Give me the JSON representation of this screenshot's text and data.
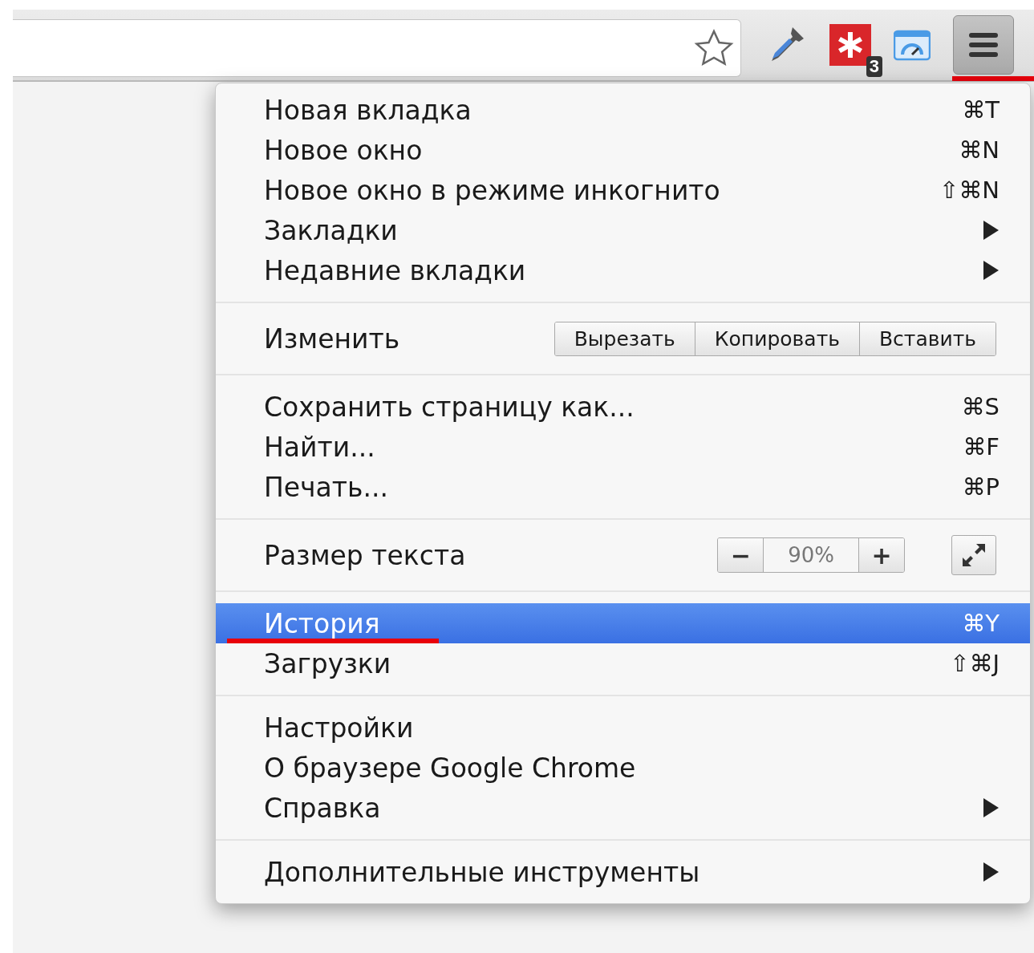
{
  "toolbar": {
    "badge": "3",
    "menu_button": {
      "pressed": true,
      "marked": true
    }
  },
  "menu": {
    "sections": [
      {
        "rows": [
          {
            "kind": "item",
            "label": "Новая вкладка",
            "shortcut": "⌘T",
            "submenu": false,
            "selected": false,
            "marked": false
          },
          {
            "kind": "item",
            "label": "Новое окно",
            "shortcut": "⌘N",
            "submenu": false,
            "selected": false,
            "marked": false
          },
          {
            "kind": "item",
            "label": "Новое окно в режиме инкогнито",
            "shortcut": "⇧⌘N",
            "submenu": false,
            "selected": false,
            "marked": false
          },
          {
            "kind": "item",
            "label": "Закладки",
            "submenu": true,
            "selected": false,
            "marked": false
          },
          {
            "kind": "item",
            "label": "Недавние вкладки",
            "submenu": true,
            "selected": false,
            "marked": false
          }
        ]
      },
      {
        "rows": [
          {
            "kind": "edit",
            "label": "Изменить",
            "buttons": [
              "Вырезать",
              "Копировать",
              "Вставить"
            ]
          }
        ]
      },
      {
        "rows": [
          {
            "kind": "item",
            "label": "Сохранить страницу как...",
            "shortcut": "⌘S",
            "submenu": false,
            "selected": false,
            "marked": false
          },
          {
            "kind": "item",
            "label": "Найти...",
            "shortcut": "⌘F",
            "submenu": false,
            "selected": false,
            "marked": false
          },
          {
            "kind": "item",
            "label": "Печать...",
            "shortcut": "⌘P",
            "submenu": false,
            "selected": false,
            "marked": false
          }
        ]
      },
      {
        "rows": [
          {
            "kind": "zoom",
            "label": "Размер текста",
            "minus": "−",
            "value": "90%",
            "plus": "+"
          }
        ]
      },
      {
        "rows": [
          {
            "kind": "item",
            "label": "История",
            "shortcut": "⌘Y",
            "submenu": false,
            "selected": true,
            "marked": true
          },
          {
            "kind": "item",
            "label": "Загрузки",
            "shortcut": "⇧⌘J",
            "submenu": false,
            "selected": false,
            "marked": false
          }
        ]
      },
      {
        "rows": [
          {
            "kind": "item",
            "label": "Настройки",
            "submenu": false,
            "selected": false,
            "marked": false
          },
          {
            "kind": "item",
            "label": "О браузере Google Chrome",
            "submenu": false,
            "selected": false,
            "marked": false
          },
          {
            "kind": "item",
            "label": "Справка",
            "submenu": true,
            "selected": false,
            "marked": false
          }
        ]
      },
      {
        "rows": [
          {
            "kind": "item",
            "label": "Дополнительные инструменты",
            "submenu": true,
            "selected": false,
            "marked": false
          }
        ]
      }
    ]
  }
}
